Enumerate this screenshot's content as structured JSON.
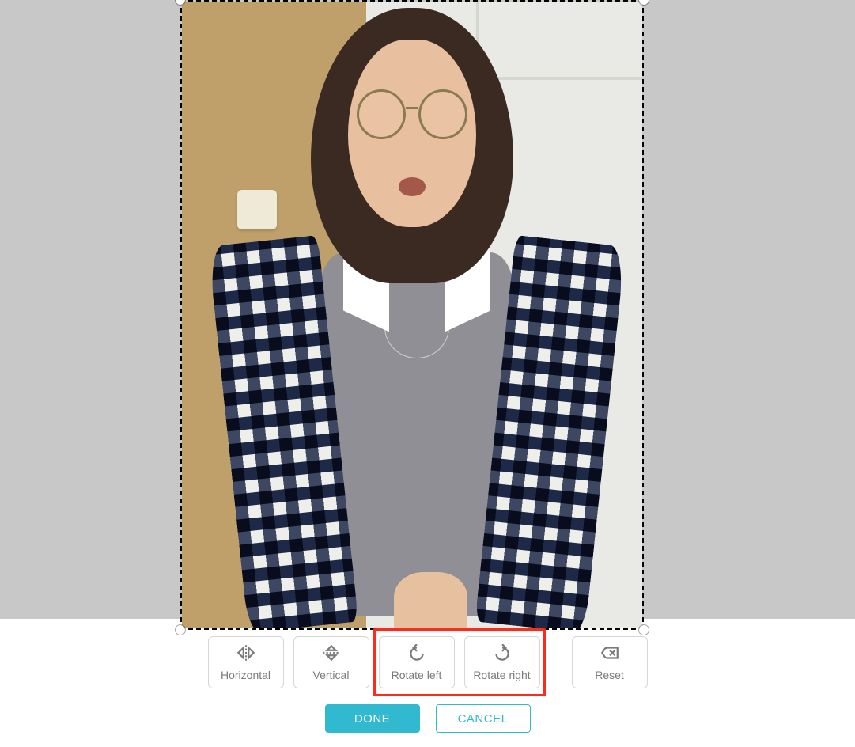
{
  "toolbar": {
    "horizontal_label": "Horizontal",
    "vertical_label": "Vertical",
    "rotate_left_label": "Rotate left",
    "rotate_right_label": "Rotate right",
    "reset_label": "Reset"
  },
  "actions": {
    "done_label": "DONE",
    "cancel_label": "CANCEL"
  },
  "colors": {
    "accent": "#31b9cf",
    "highlight": "#ff2a1a",
    "canvas_bg": "#c8c8c8"
  },
  "highlight": {
    "targets": [
      "rotate-left-button",
      "rotate-right-button"
    ]
  }
}
